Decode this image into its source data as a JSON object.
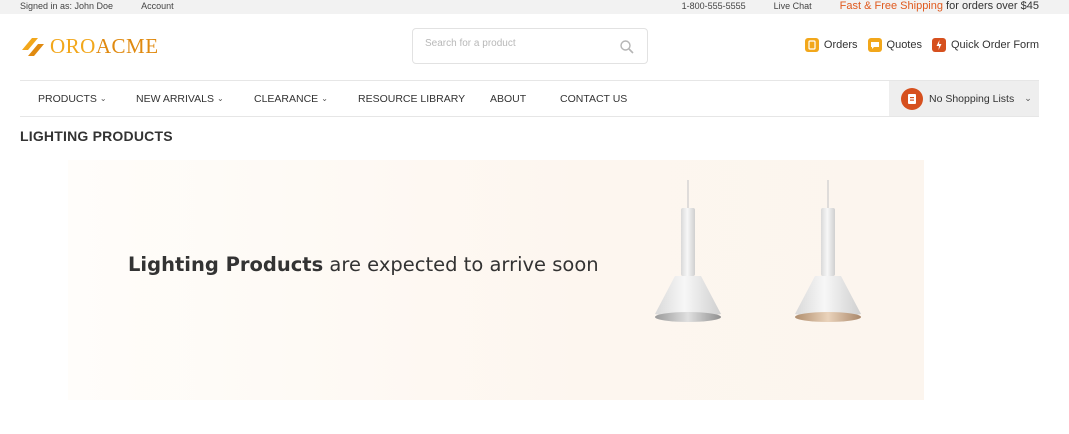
{
  "topbar": {
    "signed_in": "Signed in as: John Doe",
    "account": "Account",
    "phone": "1-800-555-5555",
    "live_chat": "Live Chat",
    "promo_highlight": "Fast & Free Shipping",
    "promo_rest": " for orders over $45"
  },
  "header": {
    "logo_oro": "ORO",
    "logo_acme": "ACME",
    "search_placeholder": "Search for a product",
    "quick_links": [
      {
        "label": "Orders",
        "color": "#f2a71b"
      },
      {
        "label": "Quotes",
        "color": "#f2a71b"
      },
      {
        "label": "Quick Order Form",
        "color": "#d6501e"
      }
    ]
  },
  "nav": {
    "items": [
      "PRODUCTS",
      "NEW ARRIVALS",
      "CLEARANCE",
      "RESOURCE LIBRARY",
      "ABOUT",
      "CONTACT US"
    ],
    "shopping_list": "No Shopping Lists"
  },
  "page": {
    "title": "LIGHTING PRODUCTS"
  },
  "banner": {
    "bold": "Lighting Products",
    "rest": " are expected to arrive soon"
  },
  "colors": {
    "brand_orange": "#e05a1e",
    "brand_yellow": "#f2a71b"
  }
}
